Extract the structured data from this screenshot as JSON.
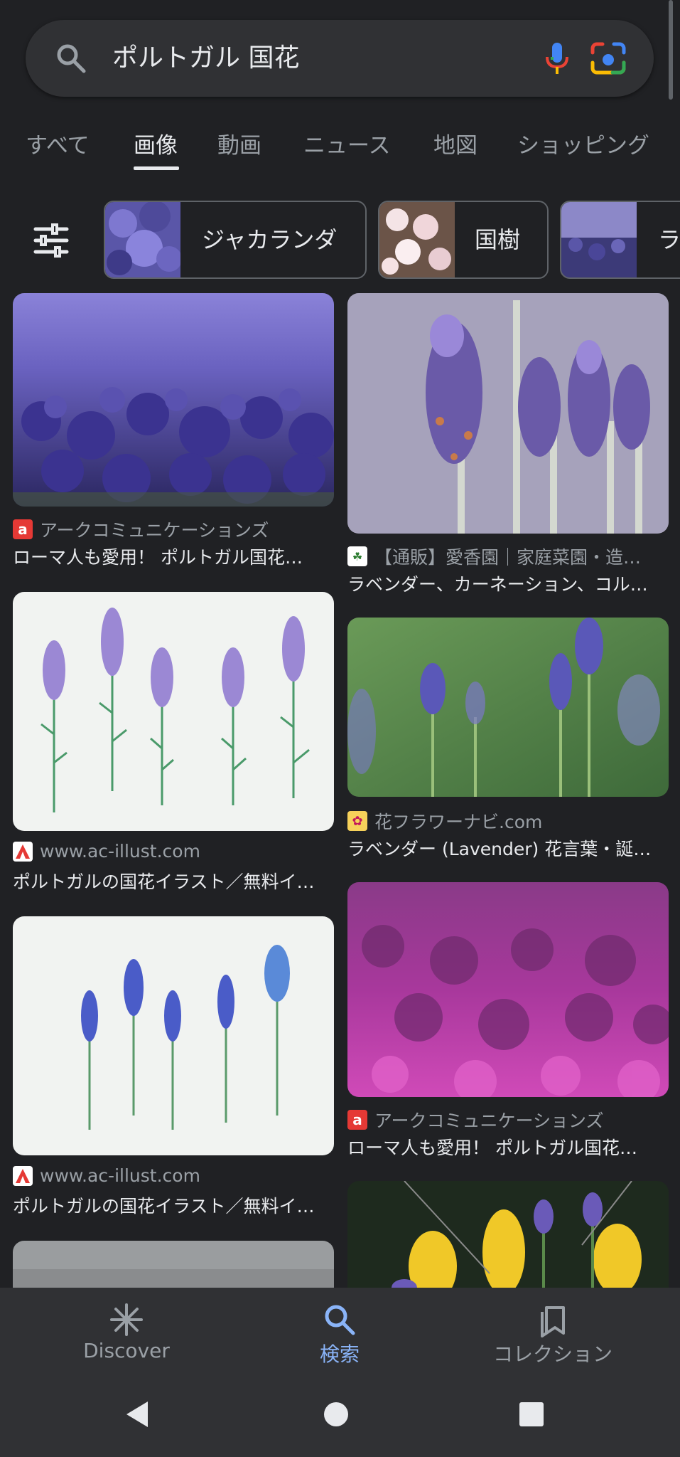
{
  "search": {
    "query": "ポルトガル 国花"
  },
  "tabs": [
    {
      "label": "すべて"
    },
    {
      "label": "画像"
    },
    {
      "label": "動画"
    },
    {
      "label": "ニュース"
    },
    {
      "label": "地図"
    },
    {
      "label": "ショッピング"
    }
  ],
  "active_tab": "画像",
  "chips": [
    {
      "label": "ジャカランダ"
    },
    {
      "label": "国樹"
    },
    {
      "label": "ラ"
    }
  ],
  "results": {
    "left": [
      {
        "source": "アークコミュニケーションズ",
        "title": "ローマ人も愛用！ ポルトガル国花…",
        "favicon": "a"
      },
      {
        "source": "www.ac-illust.com",
        "title": "ポルトガルの国花イラスト／無料イ…"
      },
      {
        "source": "www.ac-illust.com",
        "title": "ポルトガルの国花イラスト／無料イ…"
      }
    ],
    "right": [
      {
        "source": "【通販】愛香園｜家庭菜園・造…",
        "title": "ラベンダー、カーネーション、コル…"
      },
      {
        "source": "花フラワーナビ.com",
        "title": "ラベンダー (Lavender) 花言葉・誕…"
      },
      {
        "source": "アークコミュニケーションズ",
        "title": "ローマ人も愛用！ ポルトガル国花…",
        "favicon": "a"
      }
    ]
  },
  "bottom_nav": [
    {
      "label": "Discover",
      "icon": "asterisk-icon"
    },
    {
      "label": "検索",
      "icon": "search-icon"
    },
    {
      "label": "コレクション",
      "icon": "collections-icon"
    }
  ],
  "active_nav": "検索",
  "colors": {
    "background": "#202124",
    "surface": "#303134",
    "accent": "#8ab4f8"
  }
}
